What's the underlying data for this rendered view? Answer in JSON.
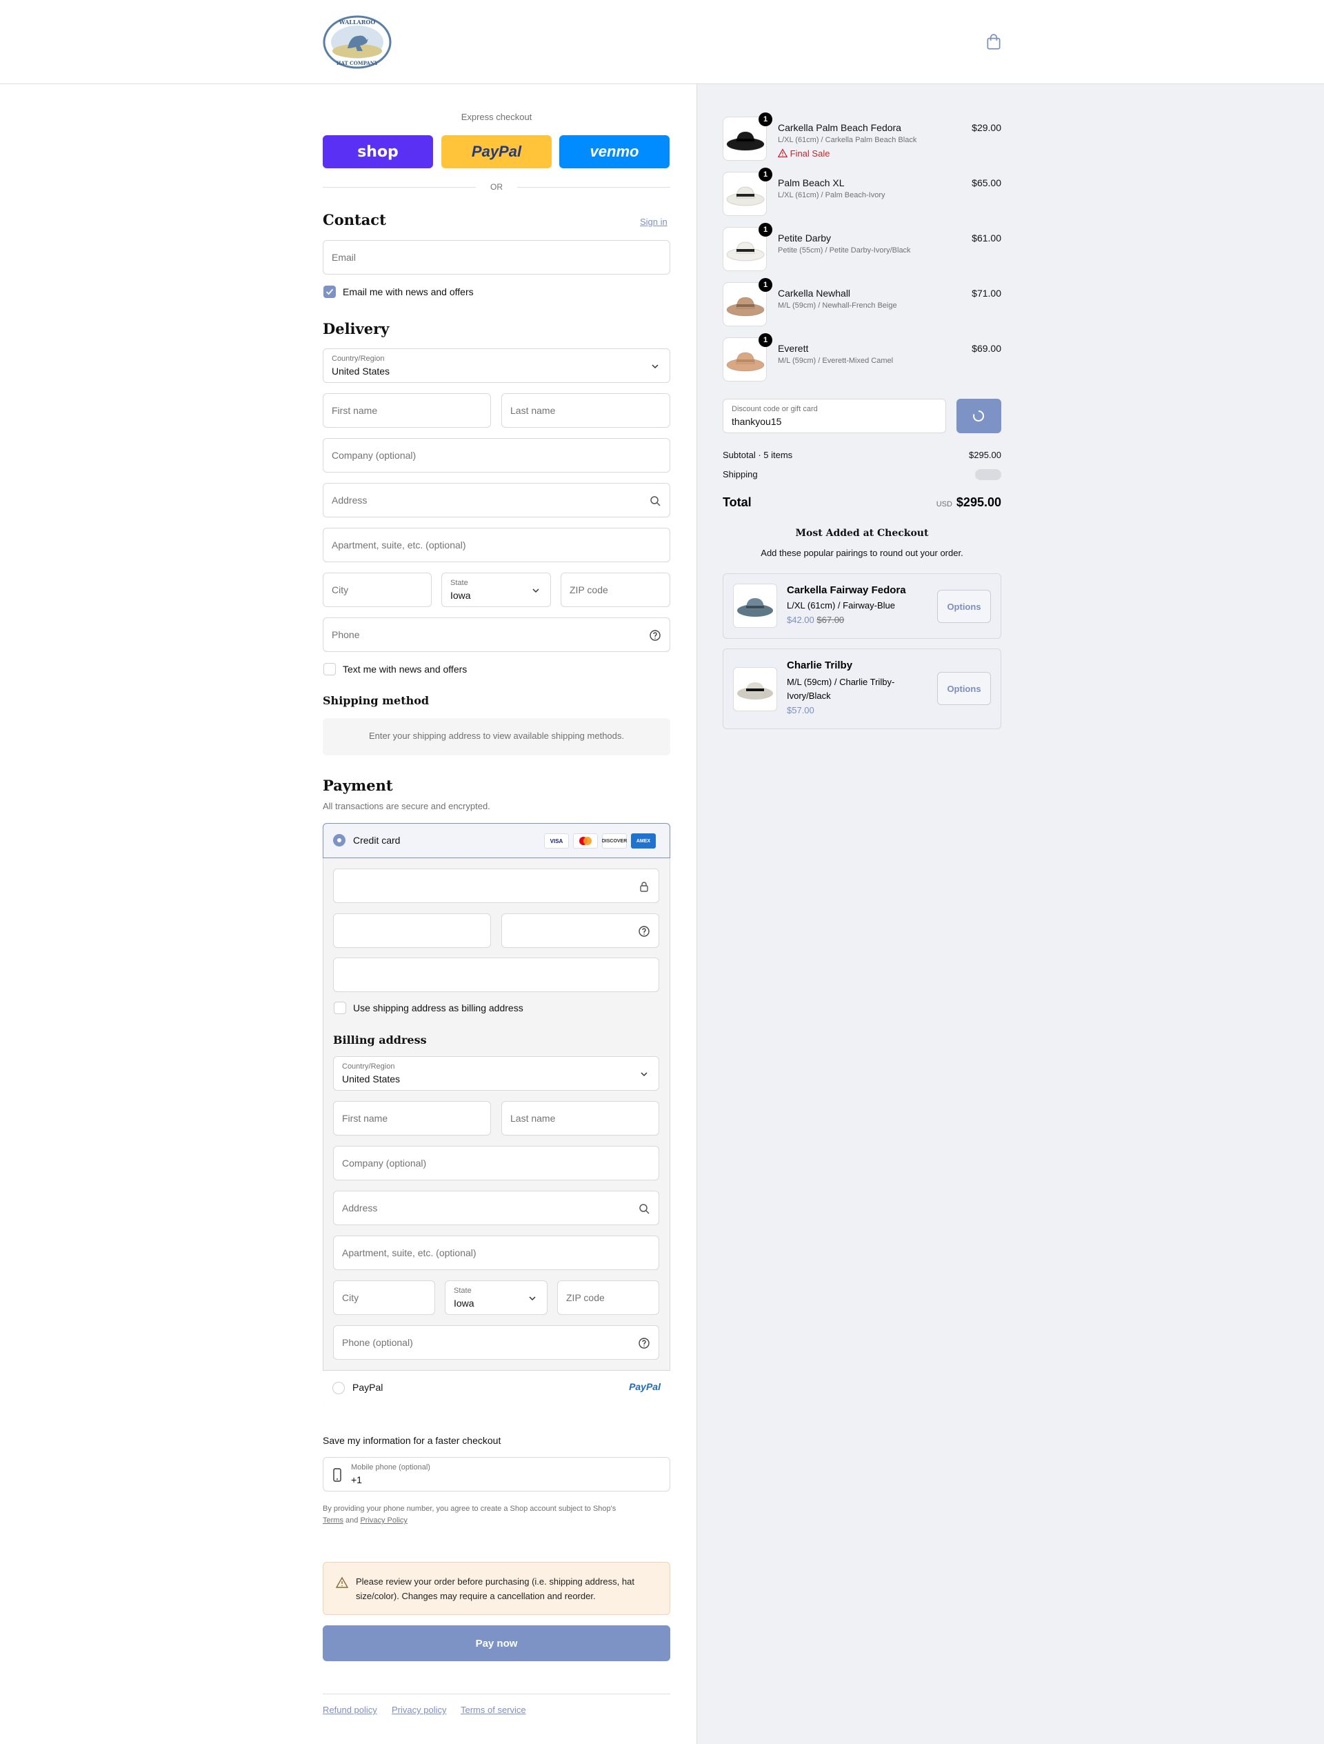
{
  "header": {
    "logo_alt": "Wallaroo Hat Company",
    "logo_text_top": "WALLAROO",
    "logo_text_bottom": "HAT COMPANY"
  },
  "express": {
    "label": "Express checkout",
    "shop": "shop",
    "paypal": "PayPal",
    "venmo": "venmo",
    "or": "OR"
  },
  "contact": {
    "title": "Contact",
    "sign_in": "Sign in",
    "email_placeholder": "Email",
    "news_label": "Email me with news and offers",
    "news_checked": true
  },
  "delivery": {
    "title": "Delivery",
    "country_label": "Country/Region",
    "country_value": "United States",
    "first_name": "First name",
    "last_name": "Last name",
    "company": "Company (optional)",
    "address": "Address",
    "apartment": "Apartment, suite, etc. (optional)",
    "city": "City",
    "state_label": "State",
    "state_value": "Iowa",
    "zip": "ZIP code",
    "phone": "Phone",
    "text_news": "Text me with news and offers"
  },
  "shipping": {
    "title": "Shipping method",
    "message": "Enter your shipping address to view available shipping methods."
  },
  "payment": {
    "title": "Payment",
    "subtitle": "All transactions are secure and encrypted.",
    "credit_card": "Credit card",
    "brands": [
      "VISA",
      "MC",
      "DISCOVER",
      "AMEX"
    ],
    "use_shipping": "Use shipping address as billing address",
    "billing_title": "Billing address",
    "billing": {
      "country_label": "Country/Region",
      "country_value": "United States",
      "first_name": "First name",
      "last_name": "Last name",
      "company": "Company (optional)",
      "address": "Address",
      "apartment": "Apartment, suite, etc. (optional)",
      "city": "City",
      "state_label": "State",
      "state_value": "Iowa",
      "zip": "ZIP code",
      "phone": "Phone (optional)"
    },
    "paypal": "PayPal",
    "paypal_logo": "PayPal"
  },
  "save_info": {
    "title": "Save my information for a faster checkout",
    "mobile_label": "Mobile phone (optional)",
    "mobile_value": "+1",
    "disclaimer": "By providing your phone number, you agree to create a Shop account subject to Shop's",
    "terms": "Terms",
    "and": "and",
    "privacy": "Privacy Policy"
  },
  "notice": "Please review your order before purchasing (i.e. shipping address, hat size/color). Changes may require a cancellation and reorder.",
  "pay_now": "Pay now",
  "footer": {
    "refund": "Refund policy",
    "privacy": "Privacy policy",
    "terms": "Terms of service"
  },
  "summary": {
    "items": [
      {
        "name": "Carkella Palm Beach Fedora",
        "variant": "L/XL (61cm) / Carkella Palm Beach Black",
        "price": "$29.00",
        "qty": "1",
        "final_sale": "Final Sale",
        "color": "#1a1a1a",
        "band": "#000000"
      },
      {
        "name": "Palm Beach XL",
        "variant": "L/XL (61cm) / Palm Beach-Ivory",
        "price": "$65.00",
        "qty": "1",
        "color": "#ecebe3",
        "band": "#222222"
      },
      {
        "name": "Petite Darby",
        "variant": "Petite (55cm) / Petite Darby-Ivory/Black",
        "price": "$61.00",
        "qty": "1",
        "color": "#f0efea",
        "band": "#222222"
      },
      {
        "name": "Carkella Newhall",
        "variant": "M/L (59cm) / Newhall-French Beige",
        "price": "$71.00",
        "qty": "1",
        "color": "#c39a7a",
        "band": "#8a6a52"
      },
      {
        "name": "Everett",
        "variant": "M/L (59cm) / Everett-Mixed Camel",
        "price": "$69.00",
        "qty": "1",
        "color": "#d9a883",
        "band": "#b88c66"
      }
    ],
    "discount_label": "Discount code or gift card",
    "discount_value": "thankyou15",
    "subtotal_label": "Subtotal · 5 items",
    "subtotal": "$295.00",
    "shipping_label": "Shipping",
    "total_label": "Total",
    "currency": "USD",
    "total": "$295.00",
    "upsell_title": "Most Added at Checkout",
    "upsell_subtitle": "Add these popular pairings to round out your order.",
    "upsells": [
      {
        "name": "Carkella Fairway Fedora",
        "variant": "L/XL (61cm) / Fairway-Blue",
        "price": "$42.00",
        "compare": "$67.00",
        "button": "Options",
        "color": "#6f8797"
      },
      {
        "name": "Charlie Trilby",
        "variant": "M/L (59cm) / Charlie Trilby-Ivory/Black",
        "price": "$57.00",
        "button": "Options",
        "color": "#dedbd2"
      }
    ]
  },
  "colors": {
    "accent": "#7d93c6",
    "shop": "#5a31f4",
    "paypal": "#ffc439",
    "venmo": "#008cff",
    "final_sale": "#c0262d"
  }
}
